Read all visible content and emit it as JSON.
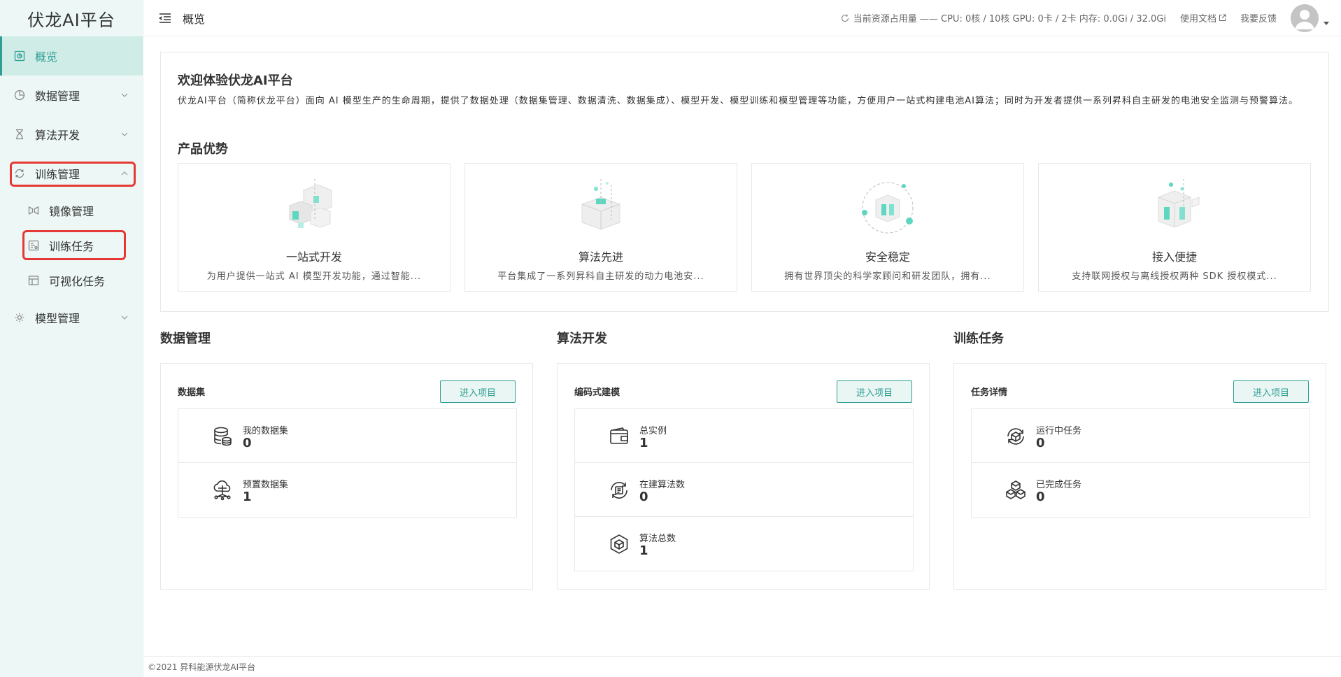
{
  "app": {
    "logo": "伏龙AI平台"
  },
  "sidebar": {
    "items": [
      {
        "label": "概览"
      },
      {
        "label": "数据管理"
      },
      {
        "label": "算法开发"
      },
      {
        "label": "训练管理"
      },
      {
        "label": "镜像管理"
      },
      {
        "label": "训练任务"
      },
      {
        "label": "可视化任务"
      },
      {
        "label": "模型管理"
      }
    ]
  },
  "header": {
    "title": "概览",
    "resource": "当前资源占用量 —— CPU: 0核 / 10核 GPU: 0卡 / 2卡 内存: 0.0Gi / 32.0Gi",
    "docs_link": "使用文档",
    "feedback_link": "我要反馈"
  },
  "intro": {
    "title": "欢迎体验伏龙AI平台",
    "description": "伏龙AI平台（简称伏龙平台）面向 AI 模型生产的生命周期，提供了数据处理（数据集管理、数据清洗、数据集成）、模型开发、模型训练和模型管理等功能，方便用户一站式构建电池AI算法；同时为开发者提供一系列昇科自主研发的电池安全监测与预警算法。",
    "advantages_title": "产品优势",
    "advantages": [
      {
        "name": "一站式开发",
        "desc": "为用户提供一站式 AI 模型开发功能，通过智能..."
      },
      {
        "name": "算法先进",
        "desc": "平台集成了一系列昇科自主研发的动力电池安..."
      },
      {
        "name": "安全稳定",
        "desc": "拥有世界顶尖的科学家顾问和研发团队，拥有..."
      },
      {
        "name": "接入便捷",
        "desc": "支持联网授权与离线授权两种 SDK 授权模式..."
      }
    ]
  },
  "sections": {
    "data": {
      "title": "数据管理",
      "panel_label": "数据集",
      "button": "进入项目",
      "stats": [
        {
          "label": "我的数据集",
          "value": "0",
          "icon": "database-icon"
        },
        {
          "label": "预置数据集",
          "value": "1",
          "icon": "cloud-network-icon"
        }
      ]
    },
    "algo": {
      "title": "算法开发",
      "panel_label": "编码式建模",
      "button": "进入项目",
      "stats": [
        {
          "label": "总实例",
          "value": "1",
          "icon": "wallet-icon"
        },
        {
          "label": "在建算法数",
          "value": "0",
          "icon": "refresh-doc-icon"
        },
        {
          "label": "算法总数",
          "value": "1",
          "icon": "cube-hex-icon"
        }
      ]
    },
    "train": {
      "title": "训练任务",
      "panel_label": "任务详情",
      "button": "进入项目",
      "stats": [
        {
          "label": "运行中任务",
          "value": "0",
          "icon": "cube-cycle-icon"
        },
        {
          "label": "已完成任务",
          "value": "0",
          "icon": "cubes-icon"
        }
      ]
    }
  },
  "footer": {
    "text": "©2021 昇科能源伏龙AI平台"
  },
  "colors": {
    "accent": "#2f9e92",
    "sidebar_bg": "#edf8f6",
    "highlight": "#e53935"
  }
}
